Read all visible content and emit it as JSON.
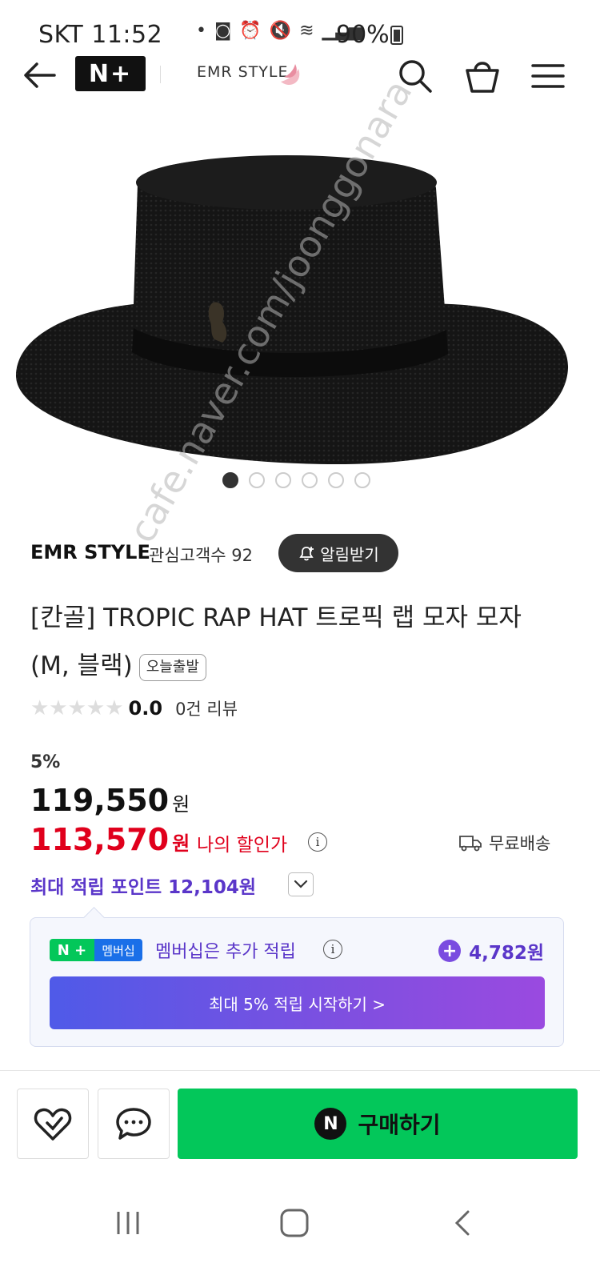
{
  "status_bar": {
    "time": "SKT 11:52",
    "battery": "90%"
  },
  "header": {
    "logo": "N+",
    "store_name": "EMR STYLE",
    "icons": [
      "back-arrow-icon",
      "search-icon",
      "shopping-bag-icon",
      "menu-icon"
    ]
  },
  "gallery": {
    "watermark": "cafe.naver.com/joonggonara",
    "total_images": 6,
    "active_index": 0
  },
  "seller": {
    "name": "EMR STYLE",
    "followers_label": "관심고객수 92",
    "notify_label": "알림받기"
  },
  "product": {
    "title": "[칸골] TROPIC RAP HAT 트로픽 랩 모자 모자 (M, 블랙)",
    "badge": "오늘출발",
    "rating": "0.0",
    "rating_value": 0,
    "rating_max": 5,
    "reviews": "0건 리뷰"
  },
  "price": {
    "discount": "5%",
    "original": "119,550",
    "sale": "113,570",
    "currency": "원",
    "my_price_label": "나의 할인가",
    "info": "i",
    "shipping": "무료배송",
    "points": "최대 적립 포인트 12,104원"
  },
  "membership": {
    "badge_n": "N +",
    "badge_label": "멤버십",
    "text": "멤버십은 추가 적립",
    "points": "4,782원",
    "cta": "최대 5% 적립 시작하기 >"
  },
  "actions": {
    "buy_icon": "N",
    "buy_label": "구매하기"
  },
  "colors": {
    "naver_green": "#03c75a",
    "sale_red": "#e0001c",
    "member_purple": "#5a36c9"
  }
}
